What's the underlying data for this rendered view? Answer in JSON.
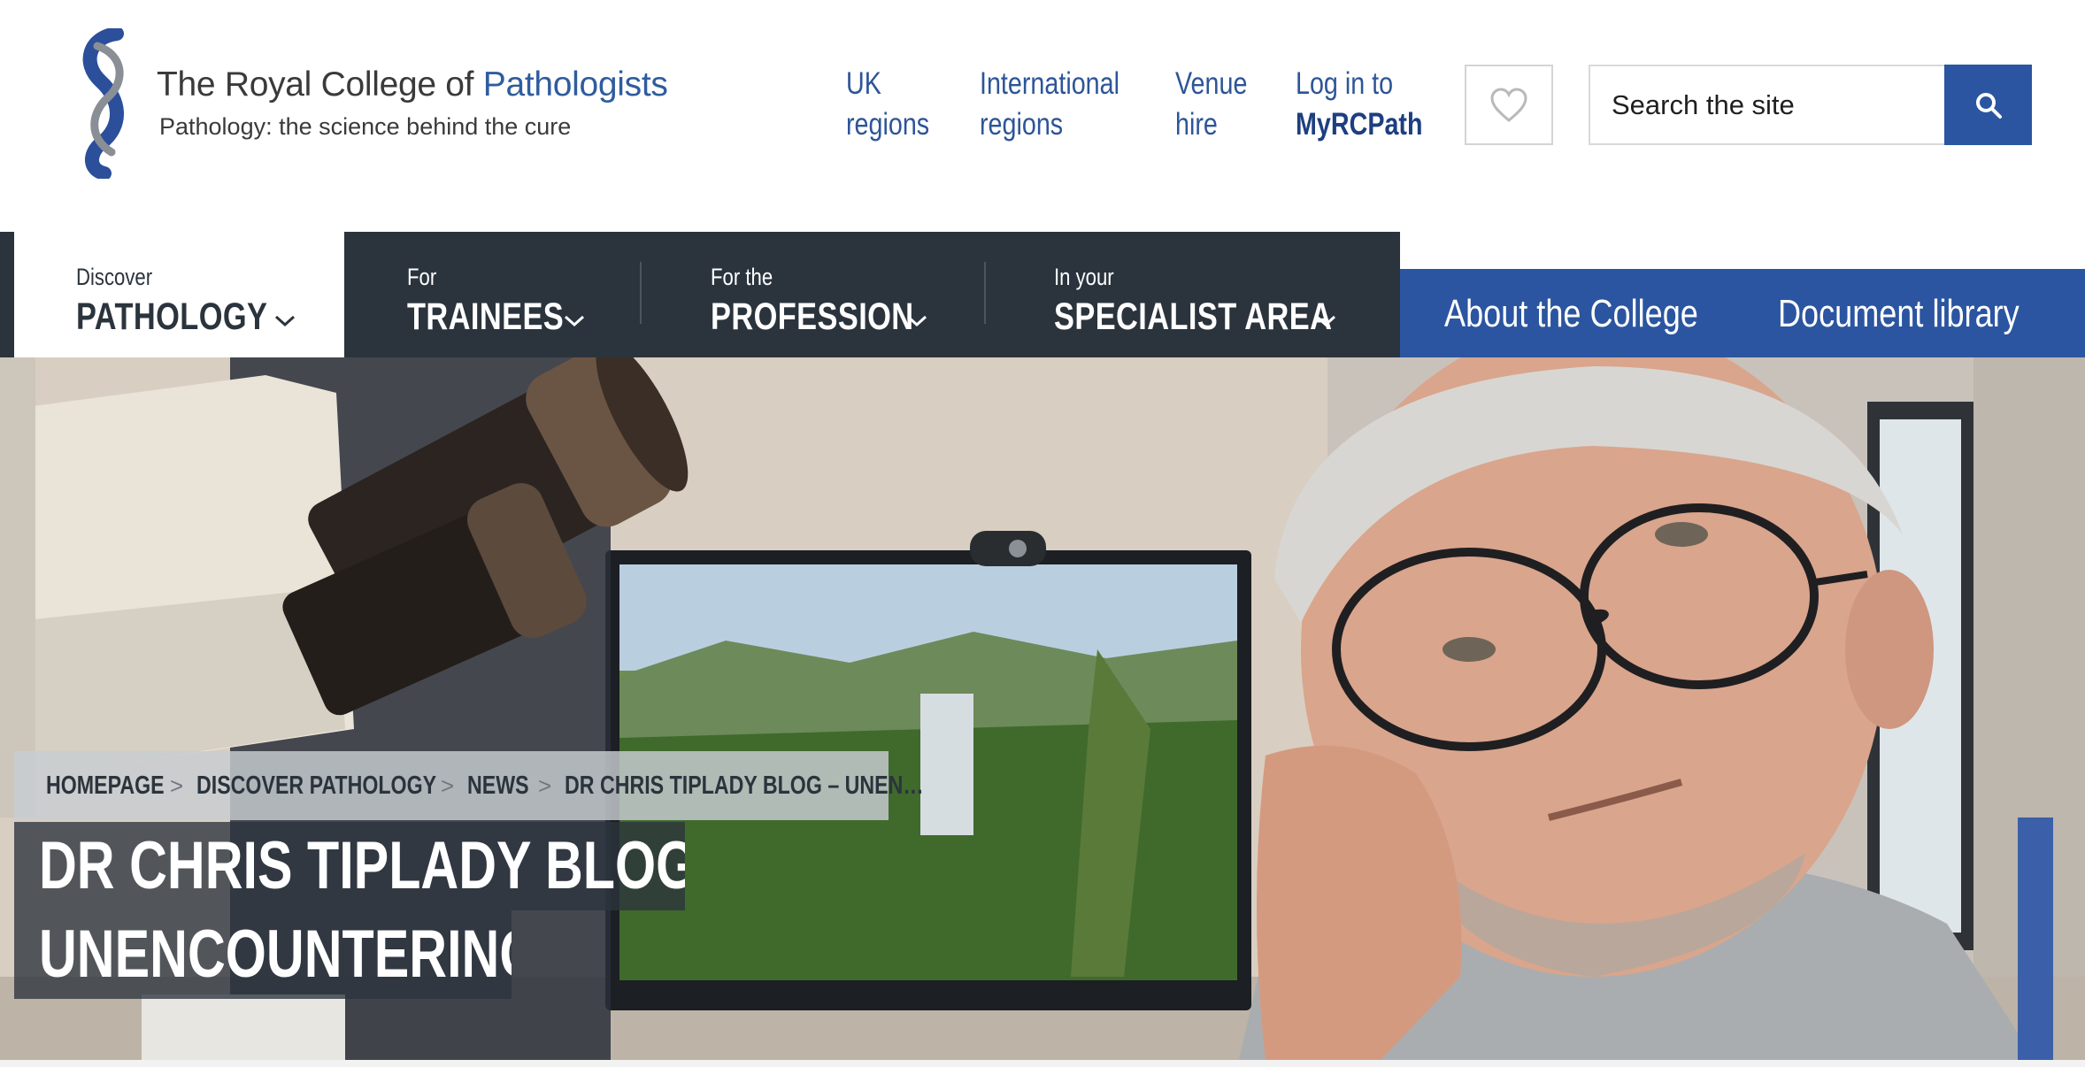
{
  "header": {
    "logo_title_main": "The Royal College of ",
    "logo_title_accent": "Pathologists",
    "logo_tagline": "Pathology: the science behind the cure",
    "links": {
      "uk_line1": "UK",
      "uk_line2": "regions",
      "intl_line1": "International",
      "intl_line2": "regions",
      "venue_line1": "Venue",
      "venue_line2": "hire",
      "login_line1": "Log in to",
      "login_line2": "MyRCPath"
    },
    "favourites_icon": "heart-icon",
    "search": {
      "placeholder": "Search the site",
      "value": "",
      "icon": "search-icon"
    }
  },
  "nav": {
    "items": [
      {
        "small": "Discover",
        "big": "PATHOLOGY"
      },
      {
        "small": "For",
        "big": "TRAINEES"
      },
      {
        "small": "For the",
        "big": "PROFESSION"
      },
      {
        "small": "In your",
        "big": "SPECIALIST AREA"
      }
    ],
    "about": "About the College",
    "document_library": "Document library"
  },
  "hero": {
    "breadcrumb": {
      "items": [
        "HOMEPAGE",
        "DISCOVER PATHOLOGY",
        "NEWS",
        "DR CHRIS TIPLADY BLOG – UNEN…"
      ],
      "separator": ">"
    },
    "title_line_1": "DR CHRIS TIPLADY BLOG –",
    "title_line_2": "UNENCOUNTERING"
  },
  "colors": {
    "brand_blue": "#2b55a0",
    "link_blue": "#2d5597",
    "nav_dark": "#2b343d"
  }
}
